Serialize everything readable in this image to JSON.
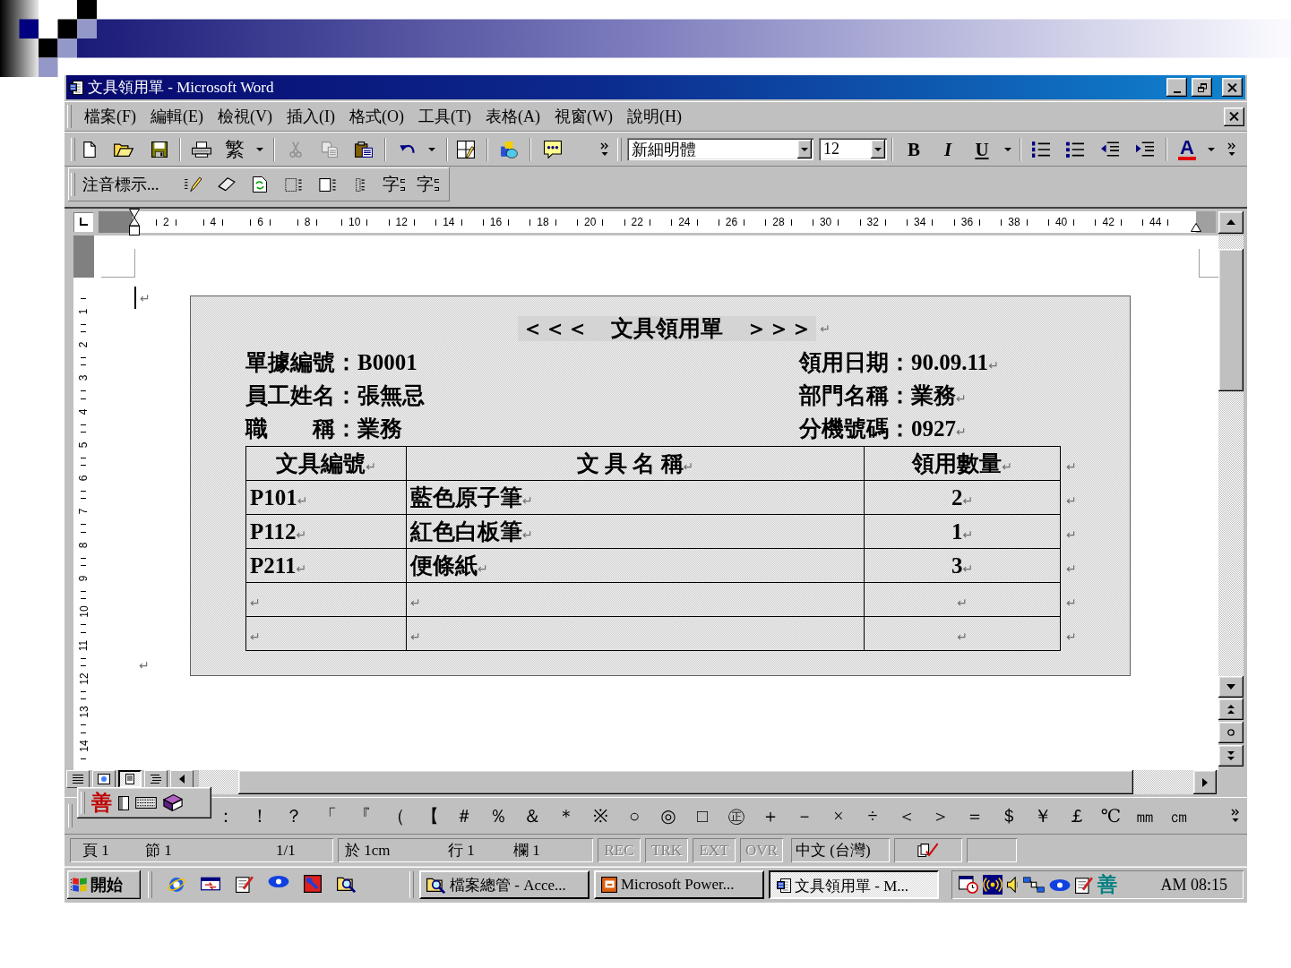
{
  "window": {
    "title": "文具領用單 - Microsoft Word"
  },
  "menu_bar": {
    "items": [
      "檔案(F)",
      "編輯(E)",
      "檢視(V)",
      "插入(I)",
      "格式(O)",
      "工具(T)",
      "表格(A)",
      "視窗(W)",
      "說明(H)"
    ]
  },
  "standard_toolbar": {
    "convert_label": "繁",
    "font": "新細明體",
    "font_size": "12",
    "format_labels": [
      "B",
      "I",
      "U"
    ],
    "font_color_label": "A"
  },
  "phonetic_toolbar": {
    "label": "注音標示...",
    "glyph_labels": [
      "字",
      "字"
    ]
  },
  "ruler": {
    "labels": [
      "2",
      "4",
      "6",
      "8",
      "10",
      "12",
      "14",
      "16",
      "18",
      "20",
      "22",
      "24",
      "26",
      "28",
      "30",
      "32",
      "34",
      "36",
      "38",
      "40",
      "42",
      "44"
    ]
  },
  "vertical_ruler": {
    "labels": [
      "1",
      "2",
      "3",
      "4",
      "5",
      "6",
      "7",
      "8",
      "9",
      "10",
      "11",
      "12",
      "13",
      "14"
    ]
  },
  "document": {
    "lead_mark": "↵",
    "end_mark": "↵",
    "text_box": {
      "title": "＜＜＜　文具領用單　＞＞＞",
      "title_mark": "↵",
      "lines": [
        {
          "left": "單據編號：B0001",
          "right": "領用日期：90.09.11",
          "mark": "↵"
        },
        {
          "left": "員工姓名：張無忌",
          "right": "部門名稱：業務",
          "mark": "↵"
        },
        {
          "left": "職　　稱：業務",
          "right": "分機號碼：0927",
          "mark": "↵"
        }
      ],
      "table": {
        "rows": [
          {
            "kind": "header",
            "cells": [
              {
                "text": "文具編號",
                "mark": "↵"
              },
              {
                "text": "文 具 名 稱",
                "mark": "↵"
              },
              {
                "text": "領用數量",
                "mark": "↵"
              }
            ],
            "end_mark": "↵"
          },
          {
            "kind": "data",
            "cells": [
              {
                "text": "P101",
                "mark": "↵"
              },
              {
                "text": "藍色原子筆",
                "mark": "↵"
              },
              {
                "text": "2",
                "mark": "↵"
              }
            ],
            "end_mark": "↵"
          },
          {
            "kind": "data",
            "cells": [
              {
                "text": "P112",
                "mark": "↵"
              },
              {
                "text": "紅色白板筆",
                "mark": "↵"
              },
              {
                "text": "1",
                "mark": "↵"
              }
            ],
            "end_mark": "↵"
          },
          {
            "kind": "data",
            "cells": [
              {
                "text": "P211",
                "mark": "↵"
              },
              {
                "text": "便條紙",
                "mark": "↵"
              },
              {
                "text": "3",
                "mark": "↵"
              }
            ],
            "end_mark": "↵"
          },
          {
            "kind": "data",
            "cells": [
              {
                "mark": "↵"
              },
              {
                "mark": "↵"
              },
              {
                "mark": "↵"
              }
            ],
            "end_mark": "↵"
          },
          {
            "kind": "data",
            "cells": [
              {
                "mark": "↵"
              },
              {
                "mark": "↵"
              },
              {
                "mark": "↵"
              }
            ],
            "end_mark": "↵"
          }
        ]
      }
    }
  },
  "horizontal_scrollbar": {
    "views": [
      {
        "kind": "normal",
        "selected": false
      },
      {
        "kind": "web",
        "selected": false
      },
      {
        "kind": "print",
        "selected": true
      },
      {
        "kind": "outline",
        "selected": false
      }
    ]
  },
  "ime_toolbar": {
    "glyph": "善"
  },
  "symbol_toolbar": {
    "symbols": [
      "：",
      "！",
      "？",
      "「",
      "『",
      "（",
      "【",
      "＃",
      "％",
      "＆",
      "＊",
      "※",
      "○",
      "◎",
      "□",
      "㊣",
      "＋",
      "－",
      "×",
      "÷",
      "＜",
      "＞",
      "＝",
      "＄",
      "￥",
      "￡",
      "℃",
      "㎜",
      "㎝"
    ]
  },
  "status_bar": {
    "page": "頁 1",
    "section": "節 1",
    "pages": "1/1",
    "position": "於 1cm",
    "line": "行 1",
    "column": "欄 1",
    "modes": [
      {
        "label": "REC",
        "disabled": true
      },
      {
        "label": "TRK",
        "disabled": true
      },
      {
        "label": "EXT",
        "disabled": true
      },
      {
        "label": "OVR",
        "disabled": true
      }
    ],
    "language": "中文 (台灣)"
  },
  "taskbar": {
    "start_label": "開始",
    "tasks": [
      {
        "kind": "explorer",
        "label": "檔案總管 - Acce...",
        "selected": false
      },
      {
        "kind": "presentation",
        "label": "Microsoft Power...",
        "selected": false
      },
      {
        "kind": "word",
        "label": "文具領用單 - M...",
        "selected": true
      }
    ],
    "tray_glyph": "善",
    "clock": "AM 08:15"
  }
}
